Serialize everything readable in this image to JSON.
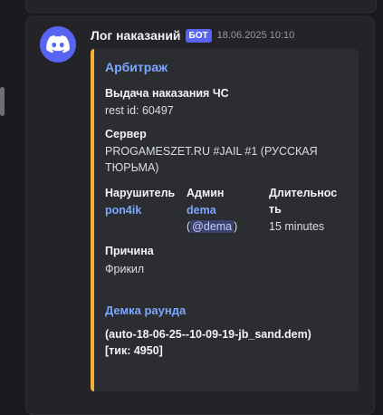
{
  "message": {
    "author": "Лог наказаний",
    "badge": "БОТ",
    "timestamp": "18.06.2025 10:10",
    "avatar_icon": "discord-logo-icon",
    "avatar_color": "#5865f2"
  },
  "embed": {
    "accent_color": "#f0b232",
    "title": "Арбитраж",
    "action": {
      "name": "Выдача наказания ЧС",
      "value": "rest id: 60497"
    },
    "server": {
      "name": "Сервер",
      "value_line1": "PROGAMESZET.RU #JAIL #1 (РУССКАЯ",
      "value_line2": "ТЮРЬМА)"
    },
    "violator": {
      "name": "Нарушитель",
      "value": "pon4ik"
    },
    "admin": {
      "name": "Админ",
      "value": "dema",
      "mention_open": "(",
      "mention": "@dema",
      "mention_close": ")"
    },
    "duration": {
      "name_line1": "Длительнос",
      "name_line2": "ть",
      "value": "15 minutes"
    },
    "reason": {
      "name": "Причина",
      "value": "Фрикил"
    },
    "demo": {
      "title": "Демка раунда",
      "line1": "(auto-18-06-25--10-09-19-jb_sand.dem)",
      "line2": "[тик: 4950]"
    }
  }
}
